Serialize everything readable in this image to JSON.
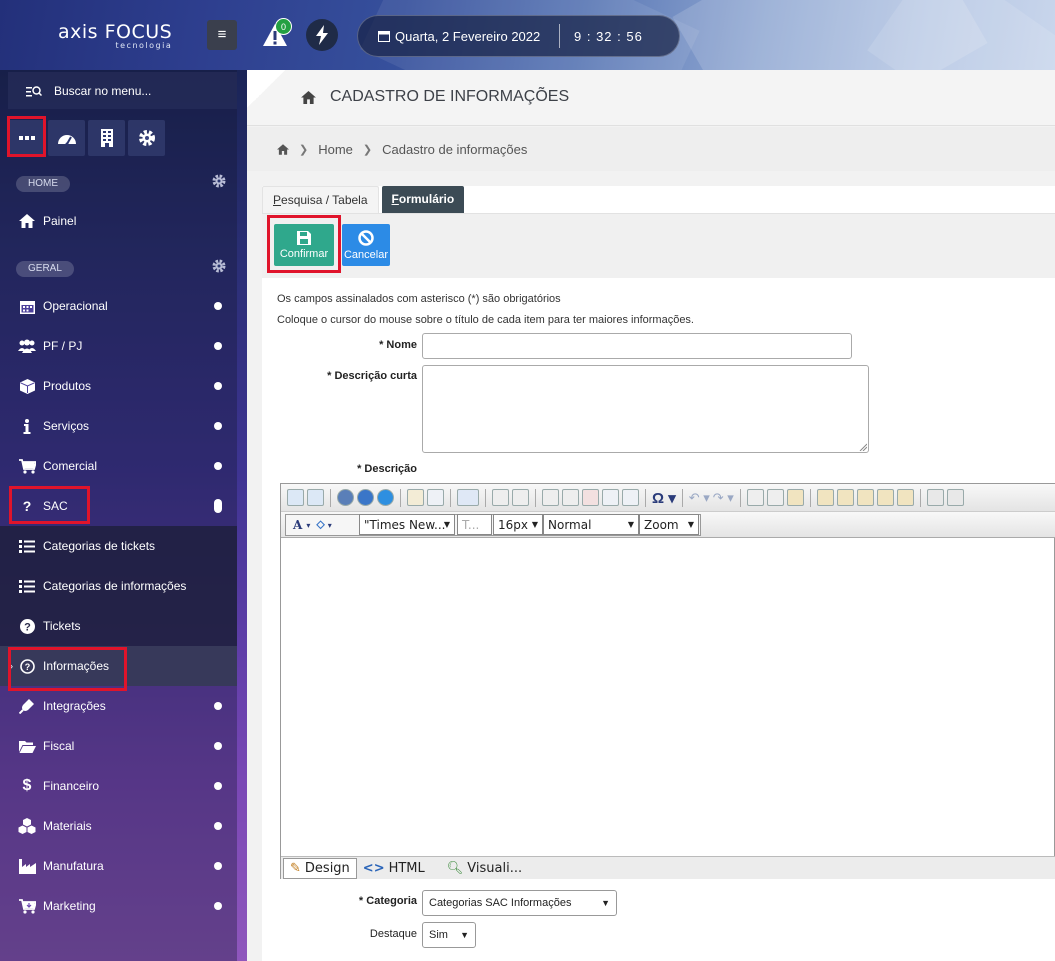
{
  "app": {
    "logo_brand": "axis FOCUS",
    "logo_sub": "tecnologia",
    "notification_count": "0",
    "date_text": "Quarta, 2 Fevereiro 2022",
    "time_text": "9 : 32 : 56"
  },
  "sidebar": {
    "search_label": "Buscar no menu...",
    "section_home": "HOME",
    "section_geral": "GERAL",
    "items": [
      {
        "label": "Painel"
      },
      {
        "label": "Operacional"
      },
      {
        "label": "PF / PJ"
      },
      {
        "label": "Produtos"
      },
      {
        "label": "Serviços"
      },
      {
        "label": "Comercial"
      },
      {
        "label": "SAC"
      },
      {
        "label": "Categorias de tickets"
      },
      {
        "label": "Categorias de informações"
      },
      {
        "label": "Tickets"
      },
      {
        "label": "Informações"
      },
      {
        "label": "Integrações"
      },
      {
        "label": "Fiscal"
      },
      {
        "label": "Financeiro"
      },
      {
        "label": "Materiais"
      },
      {
        "label": "Manufatura"
      },
      {
        "label": "Marketing"
      }
    ]
  },
  "page": {
    "title": "CADASTRO DE INFORMAÇÕES",
    "breadcrumb_home": "Home",
    "breadcrumb_current": "Cadastro de informações",
    "tab_search_rest": "esquisa / Tabela",
    "tab_search_u": "P",
    "tab_form_u": "F",
    "tab_form_rest": "ormulário",
    "confirm_label": "Confirmar",
    "cancel_label": "Cancelar",
    "info_line1": "Os campos assinalados com asterisco (*) são obrigatórios",
    "info_line2": "Coloque o cursor do mouse sobre o título de cada item para ter maiores informações.",
    "label_nome": "* Nome",
    "label_desc_curta": "* Descrição curta",
    "label_descricao": "* Descrição",
    "label_categoria": "* Categoria",
    "categoria_value": "Categorias SAC Informações",
    "label_destaque": "Destaque",
    "destaque_value": "Sim"
  },
  "editor": {
    "font_color_label": "A",
    "font_family": "\"Times New...",
    "font_style_placeholder": "T...",
    "font_size": "16px",
    "format": "Normal",
    "zoom": "Zoom",
    "mode_design": "Design",
    "mode_html": "HTML",
    "mode_preview": "Visuali..."
  },
  "colors": {
    "confirm": "#2fa88c",
    "cancel": "#2c8be6",
    "highlight": "#e0142b",
    "badge": "#23a042"
  }
}
